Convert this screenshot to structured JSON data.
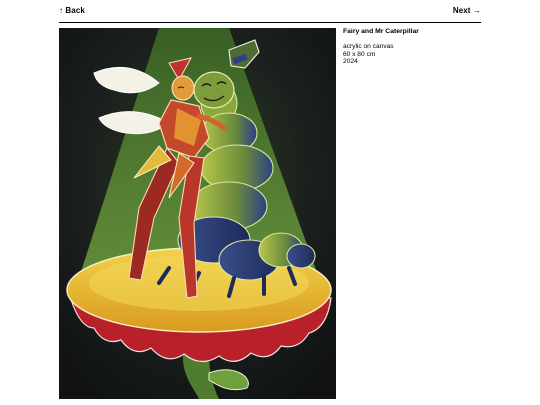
{
  "nav": {
    "back_label": "↑ Back",
    "next_label": "Next →"
  },
  "artwork": {
    "title": "Fairy and Mr Caterpillar",
    "medium": "acrylic on canvas",
    "size": "60 x 80 cm",
    "year": "2024"
  },
  "colors": {
    "background": "#ffffff",
    "text": "#000000",
    "canvas_dark": "#17181a",
    "spotlight_green": "#5a8a34",
    "mushroom_yellow": "#e8b832",
    "mushroom_red": "#b8202a",
    "caterpillar_blue": "#2c3f86"
  }
}
